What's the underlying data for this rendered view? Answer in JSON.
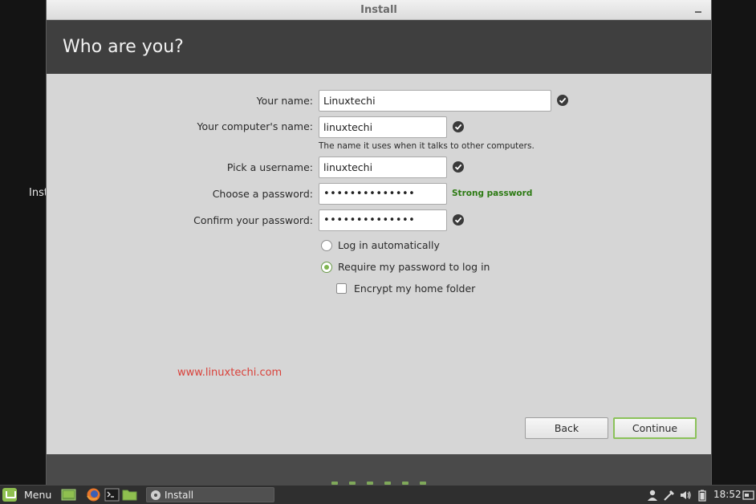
{
  "desktop": {
    "partial_label": "Inst"
  },
  "window": {
    "title": "Install"
  },
  "header": {
    "title": "Who are you?"
  },
  "form": {
    "name_label": "Your name:",
    "name_value": "Linuxtechi",
    "computer_label": "Your computer's name:",
    "computer_value": "linuxtechi",
    "computer_hint": "The name it uses when it talks to other computers.",
    "username_label": "Pick a username:",
    "username_value": "linuxtechi",
    "password_label": "Choose a password:",
    "password_value": "••••••••••••••",
    "password_strength": "Strong password",
    "confirm_label": "Confirm your password:",
    "confirm_value": "••••••••••••••",
    "login_auto_label": "Log in automatically",
    "login_password_label": "Require my password to log in",
    "encrypt_label": "Encrypt my home folder",
    "selected_login": "Require my password to log in",
    "encrypt_checked": false
  },
  "watermark": "www.linuxtechi.com",
  "buttons": {
    "back": "Back",
    "continue": "Continue"
  },
  "progress": {
    "steps": 6
  },
  "taskbar": {
    "menu_label": "Menu",
    "launchers": [
      "show-desktop-icon",
      "firefox-icon",
      "terminal-icon",
      "files-icon"
    ],
    "task_label": "Install",
    "tray": [
      "user-icon",
      "network-icon",
      "volume-icon",
      "battery-icon"
    ],
    "clock": "18:52",
    "accent": "#8fc04f"
  },
  "colors": {
    "header_bg": "#3f3f3f",
    "strength_text": "#2c7a12",
    "watermark": "#d9413a",
    "continue_border": "#8bc25a"
  }
}
